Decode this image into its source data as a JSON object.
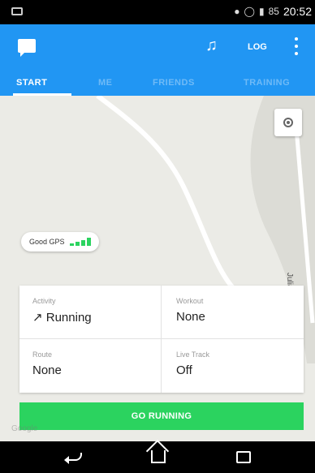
{
  "status_bar": {
    "time": "20:52",
    "battery": "85",
    "icons": [
      "location-pin-icon",
      "alarm-icon",
      "signal-icon",
      "battery-icon"
    ]
  },
  "app_bar": {
    "log_label": "LOG"
  },
  "tabs": [
    {
      "label": "START",
      "active": true
    },
    {
      "label": "ME",
      "active": false
    },
    {
      "label": "FRIENDS",
      "active": false
    },
    {
      "label": "TRAINING",
      "active": false
    }
  ],
  "map": {
    "street_label": "Julia Oh Ave",
    "gps_status": "Good GPS",
    "attribution": "Google"
  },
  "card": {
    "activity": {
      "label": "Activity",
      "value": "Running"
    },
    "workout": {
      "label": "Workout",
      "value": "None"
    },
    "route": {
      "label": "Route",
      "value": "None"
    },
    "live_track": {
      "label": "Live Track",
      "value": "Off"
    }
  },
  "actions": {
    "go_running": "GO RUNNING"
  },
  "colors": {
    "primary": "#2196f3",
    "accent_green": "#2bd35f",
    "map_bg": "#ebebe6"
  }
}
